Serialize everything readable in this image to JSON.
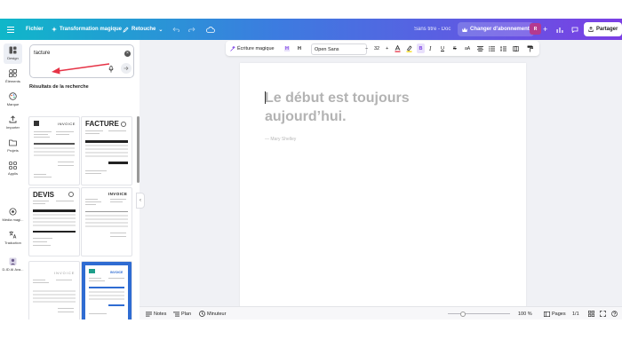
{
  "topbar": {
    "file_label": "Fichier",
    "magic_label": "Transformation magique",
    "edit_label": "Retouche",
    "doc_title": "Sans titre - Doc",
    "upgrade_label": "Changer d'abonnement",
    "avatar_text": "R",
    "share_label": "Partager"
  },
  "sidebar": {
    "items": [
      {
        "label": "Design",
        "icon": "layout-icon"
      },
      {
        "label": "Éléments",
        "icon": "shapes-icon"
      },
      {
        "label": "Marque",
        "icon": "brand-icon"
      },
      {
        "label": "Importer",
        "icon": "upload-icon"
      },
      {
        "label": "Projets",
        "icon": "folder-icon"
      },
      {
        "label": "Applis",
        "icon": "apps-icon"
      },
      {
        "label": "Média magi...",
        "icon": "magic-media-icon"
      },
      {
        "label": "Traduction",
        "icon": "translate-icon"
      },
      {
        "label": "D-ID AI Ava...",
        "icon": "avatar-app-icon"
      }
    ]
  },
  "search": {
    "value": "facture",
    "clear_icon": "close-circle-icon",
    "mic_icon": "microphone-icon",
    "submit_icon": "arrow-right-icon"
  },
  "results": {
    "heading": "Résultats de la recherche",
    "templates": [
      {
        "title": "INVOICE"
      },
      {
        "title": "FACTURE"
      },
      {
        "title": "DEVIS"
      },
      {
        "title": "INVOICE"
      },
      {
        "title": "INVOICE"
      },
      {
        "title": "INVOICE"
      }
    ]
  },
  "text_toolbar": {
    "magic_write": "Écriture magique",
    "font_name": "Open Sans",
    "font_size": "32"
  },
  "document": {
    "quote": "Le début est toujours aujourd’hui.",
    "author": "— Mary Shelley"
  },
  "bottombar": {
    "notes_label": "Notes",
    "plan_label": "Plan",
    "timer_label": "Minuteur",
    "zoom_label": "100 %",
    "pages_label": "Pages",
    "page_count": "1/1",
    "zoom_fraction": 0.24
  },
  "colors": {
    "topbar_gradient_start": "#0fb7c9",
    "topbar_gradient_end": "#7b3fe4",
    "annotation_arrow": "#e63346",
    "quote_text": "#b3b3b3"
  }
}
